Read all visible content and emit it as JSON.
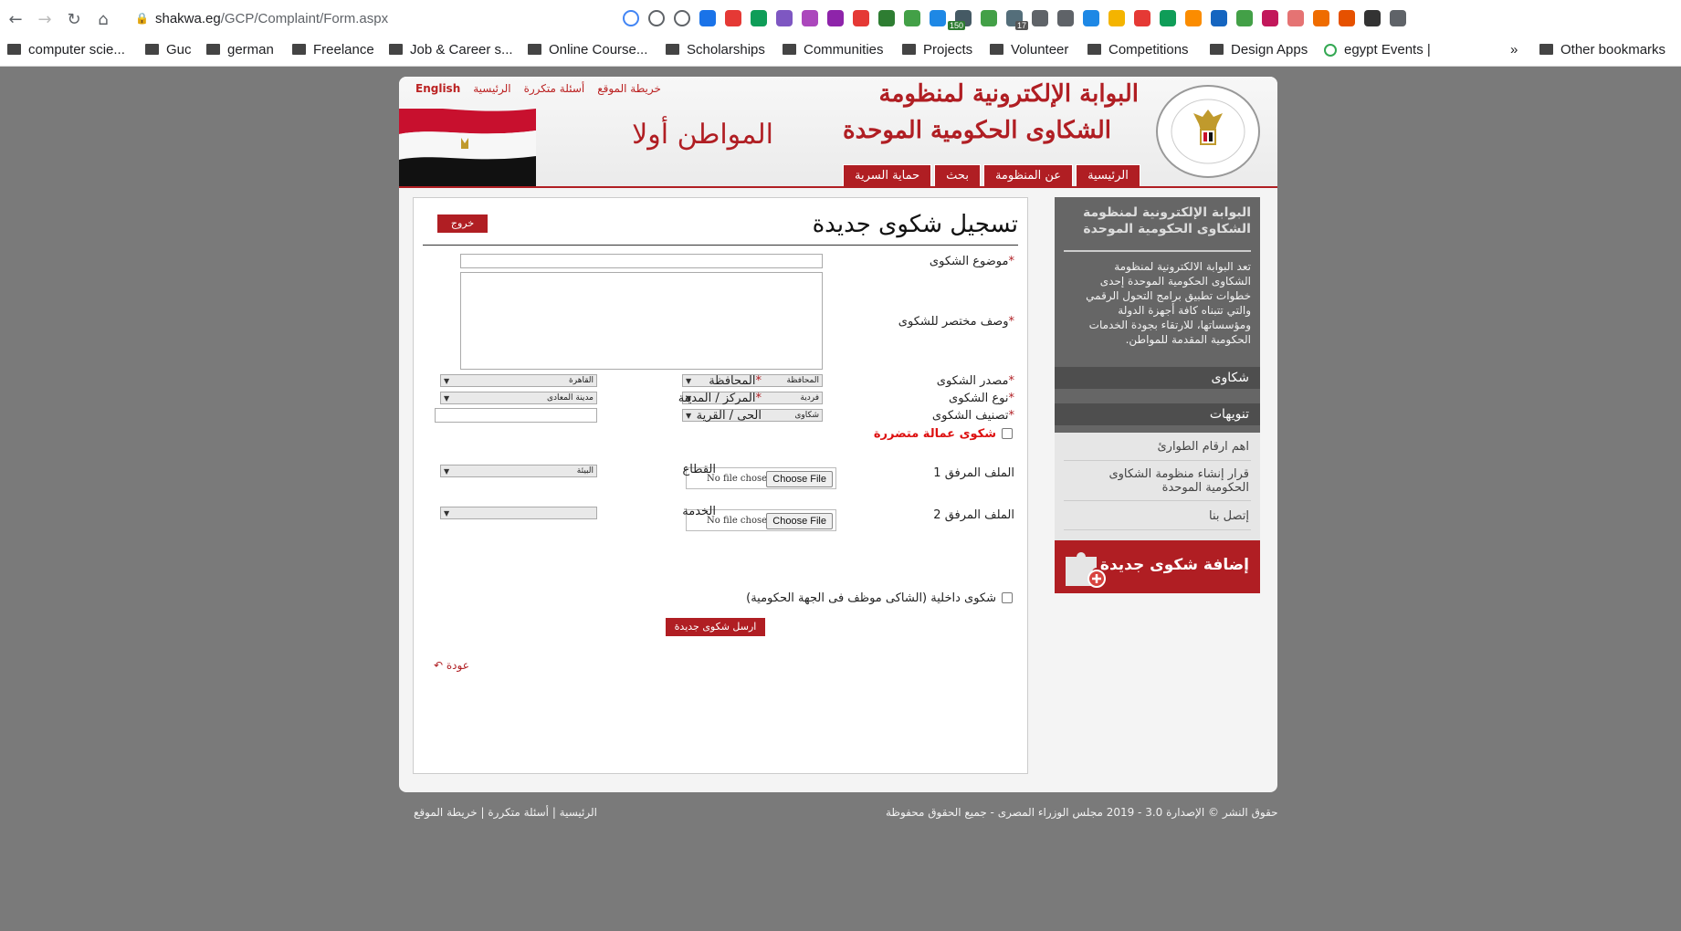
{
  "browser": {
    "url_domain": "shakwa.eg",
    "url_path": "/GCP/Complaint/Form.aspx",
    "extensions": [
      "google-icon",
      "share-icon",
      "star-icon",
      "ext-1",
      "ext-2",
      "ext-3",
      "ext-4",
      "ext-5",
      "ext-6",
      "ext-7",
      "ext-8",
      "ext-9",
      "ext-10",
      "ext-11",
      "ext-12",
      "ext-13",
      "ext-14",
      "ext-15",
      "ext-16",
      "ext-17",
      "ext-18",
      "ext-19",
      "ext-20",
      "ext-21",
      "ext-22",
      "ext-23",
      "ext-24",
      "ext-25",
      "ext-26",
      "ext-27",
      "ext-28"
    ],
    "ext_badge_1": "150",
    "ext_badge_2": "17",
    "bookmarks": [
      "computer scie...",
      "Guc",
      "german",
      "Freelance",
      "Job & Career s...",
      "Online Course...",
      "Scholarships",
      "Communities",
      "Projects",
      "Volunteer",
      "Competitions",
      "Design Apps",
      "egypt Events |"
    ],
    "more": "»",
    "other_bookmarks": "Other bookmarks"
  },
  "header": {
    "top_links": {
      "english": "English",
      "home": "الرئيسية",
      "faq": "أسئلة متكررة",
      "sitemap": "خريطة الموقع"
    },
    "title_line1": "البوابة الإلكترونية لمنظومة",
    "title_line2": "الشكاوى الحكومية الموحدة",
    "slogan": "المواطن أولا",
    "seal_text_top": "منظومة الشكاوى الحكومية الموحدة",
    "seal_text_bottom": "مجلس الـوزراء",
    "nav": [
      "الرئيسية",
      "عن المنظومة",
      "بحث",
      "حماية السرية"
    ]
  },
  "form": {
    "title": "تسجيل شكوى جديدة",
    "logout": "خروج",
    "subject_label": "موضوع الشكوى",
    "description_label": "وصف مختصر للشكوى",
    "source_label": "مصدر الشكوى",
    "source_value": "المحافظة",
    "governorate_label": "المحافظة",
    "governorate_value": "القاهرة",
    "type_label": "نوع الشكوى",
    "type_value": "فردية",
    "city_label": "المركز / المدينة",
    "city_value": "مدينة المعادى",
    "category_label": "تصنيف الشكوى",
    "category_value": "شكاوى",
    "district_label": "الحى / القرية",
    "labor_label": "شكوى عمالة متضررة",
    "attachment1_label": "الملف المرفق 1",
    "attachment2_label": "الملف المرفق 2",
    "no_file": "No file chosen",
    "choose_file": "Choose File",
    "sector_label": "القطاع",
    "sector_value": "البيئة",
    "service_label": "الخدمة",
    "service_value": "",
    "internal_label": "شكوى داخلية (الشاكى موظف فى الجهة الحكومية)",
    "submit": "ارسل شكوى جديدة",
    "back": "عودة",
    "required_mark": "*"
  },
  "sidebar": {
    "title": "البوابة الإلكترونية لمنظومة الشكاوى الحكومية الموحدة",
    "description": "تعد البوابة الالكترونية لمنظومة الشكاوى الحكومية الموحدة إحدى خطوات تطبيق برامج التحول الرقمي والتي تتبناه كافة أجهزة الدولة ومؤسساتها، للارتقاء بجودة الخدمات الحكومية المقدمة للمواطن.",
    "complaints_header": "شكاوى",
    "notices_header": "تنويهات",
    "links": [
      "اهم ارقام الطوارئ",
      "قرار إنشاء منظومة الشكاوى الحكومية الموحدة",
      "إتصل بنا"
    ],
    "add_banner": "إضافة شكوى جديدة"
  },
  "footer": {
    "copyright": "حقوق النشر © الإصدارة 3.0 - 2019 مجلس الوزراء المصرى - جميع الحقوق محفوظة",
    "links": "الرئيسية | أسئلة متكررة | خريطة الموقع"
  },
  "colors": {
    "accent": "#b01e23",
    "page_bg": "#7a7a7a",
    "sidebar": "#666666"
  }
}
